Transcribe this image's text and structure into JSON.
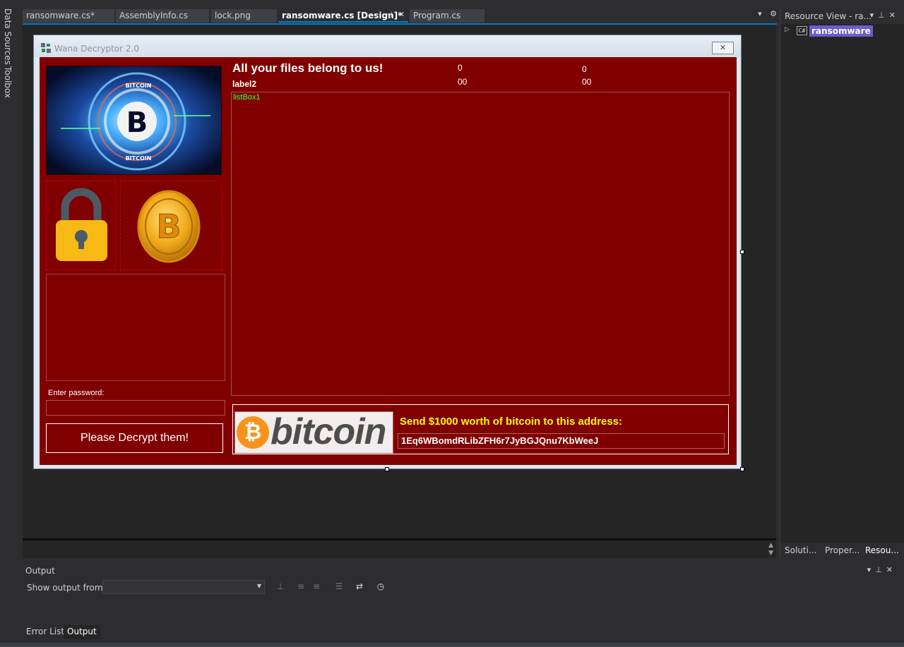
{
  "left_strip": {
    "data_sources": "Data Sources",
    "toolbox": "Toolbox"
  },
  "tabs": [
    {
      "label": "ransomware.cs*"
    },
    {
      "label": "AssemblyInfo.cs"
    },
    {
      "label": "lock.png"
    },
    {
      "label": "ransomware.cs [Design]*"
    },
    {
      "label": "Program.cs"
    }
  ],
  "form": {
    "title": "Wana Decryptor 2.0",
    "heading": "All your files belong to us!",
    "label2": "label2",
    "num_top_1": "0",
    "num_top_2": "0",
    "num_bottom_1": "00",
    "num_bottom_2": "00",
    "listbox_label": "listBox1",
    "password_label": "Enter password:",
    "decrypt_button": "Please Decrypt them!",
    "bitcoin_word": "bitcoin",
    "send_text": "Send $1000 worth of bitcoin to this address:",
    "address": "1Eq6WBomdRLibZFH6r7JyBGJQnu7KbWeeJ",
    "pic_label_bitcoin": "BITCOIN"
  },
  "resource_view": {
    "title": "Resource View - ra...",
    "tree_root": "ransomware",
    "tabs": [
      "Soluti...",
      "Proper...",
      "Resou..."
    ]
  },
  "output": {
    "title": "Output",
    "show_from_label": "Show output from:",
    "show_from_value": ""
  },
  "bottom_tabs": [
    "Error List",
    "Output"
  ],
  "colors": {
    "form_bg": "#800000",
    "accent": "#007acc",
    "send_text": "#ffff00",
    "listbox_label": "#3cff3c",
    "bitcoin_orange": "#f7931a"
  }
}
